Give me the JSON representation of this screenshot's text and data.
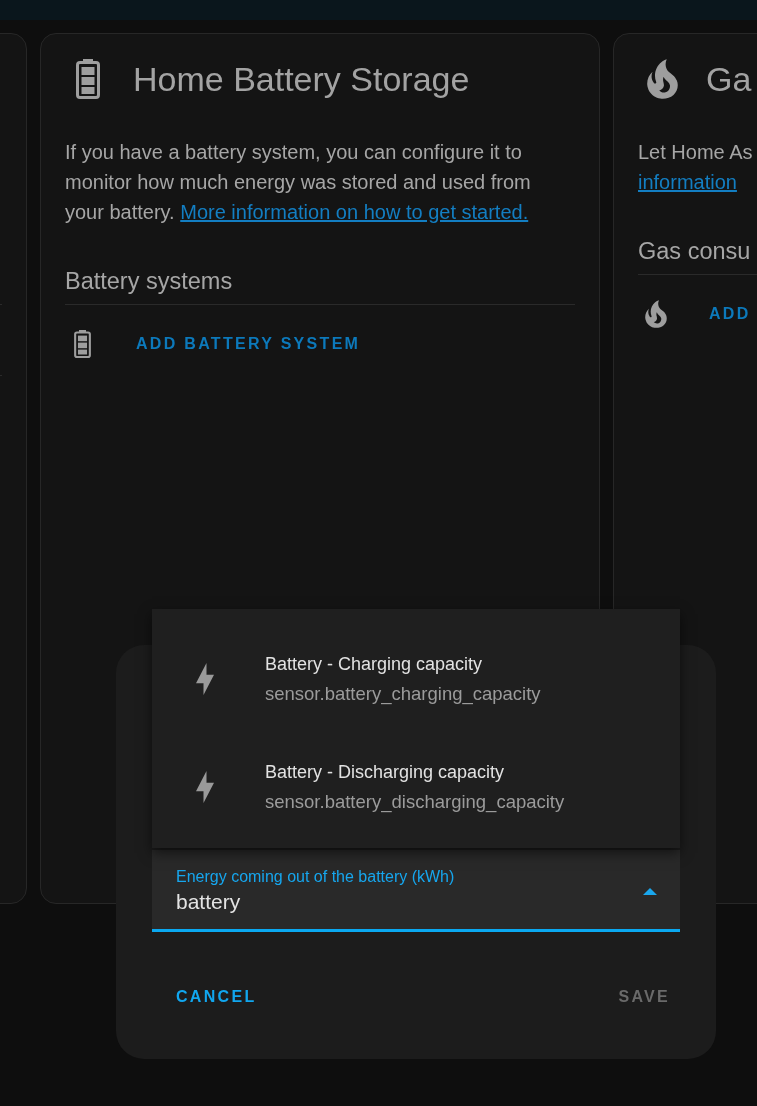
{
  "cards": [
    {
      "kind": "battery",
      "title": "Home Battery Storage",
      "description_lines": [
        {
          "text": "If you have a battery system, you can configure it to"
        },
        {
          "text": "monitor how much energy was stored and used from"
        },
        {
          "text": "your battery.",
          "link": "More information on how to get started."
        }
      ],
      "section_title": "Battery systems",
      "add_button": "ADD BATTERY SYSTEM"
    },
    {
      "kind": "gas",
      "title": "Ga",
      "description_lines": [
        {
          "text": "Let Home As"
        },
        {
          "link": "information"
        }
      ],
      "section_title": "Gas consu",
      "add_button": "ADD"
    }
  ],
  "dialog": {
    "options": [
      {
        "name": "Battery - Charging capacity",
        "entity_id": "sensor.battery_charging_capacity",
        "selected": false
      },
      {
        "name": "Battery - Discharging capacity",
        "entity_id": "sensor.battery_discharging_capacity",
        "selected": false
      }
    ],
    "field": {
      "label": "Energy coming out of the battery (kWh)",
      "value": "battery",
      "expanded": true
    },
    "buttons": [
      {
        "label": "CANCEL",
        "disabled": false
      },
      {
        "label": "SAVE",
        "disabled": true
      }
    ]
  }
}
